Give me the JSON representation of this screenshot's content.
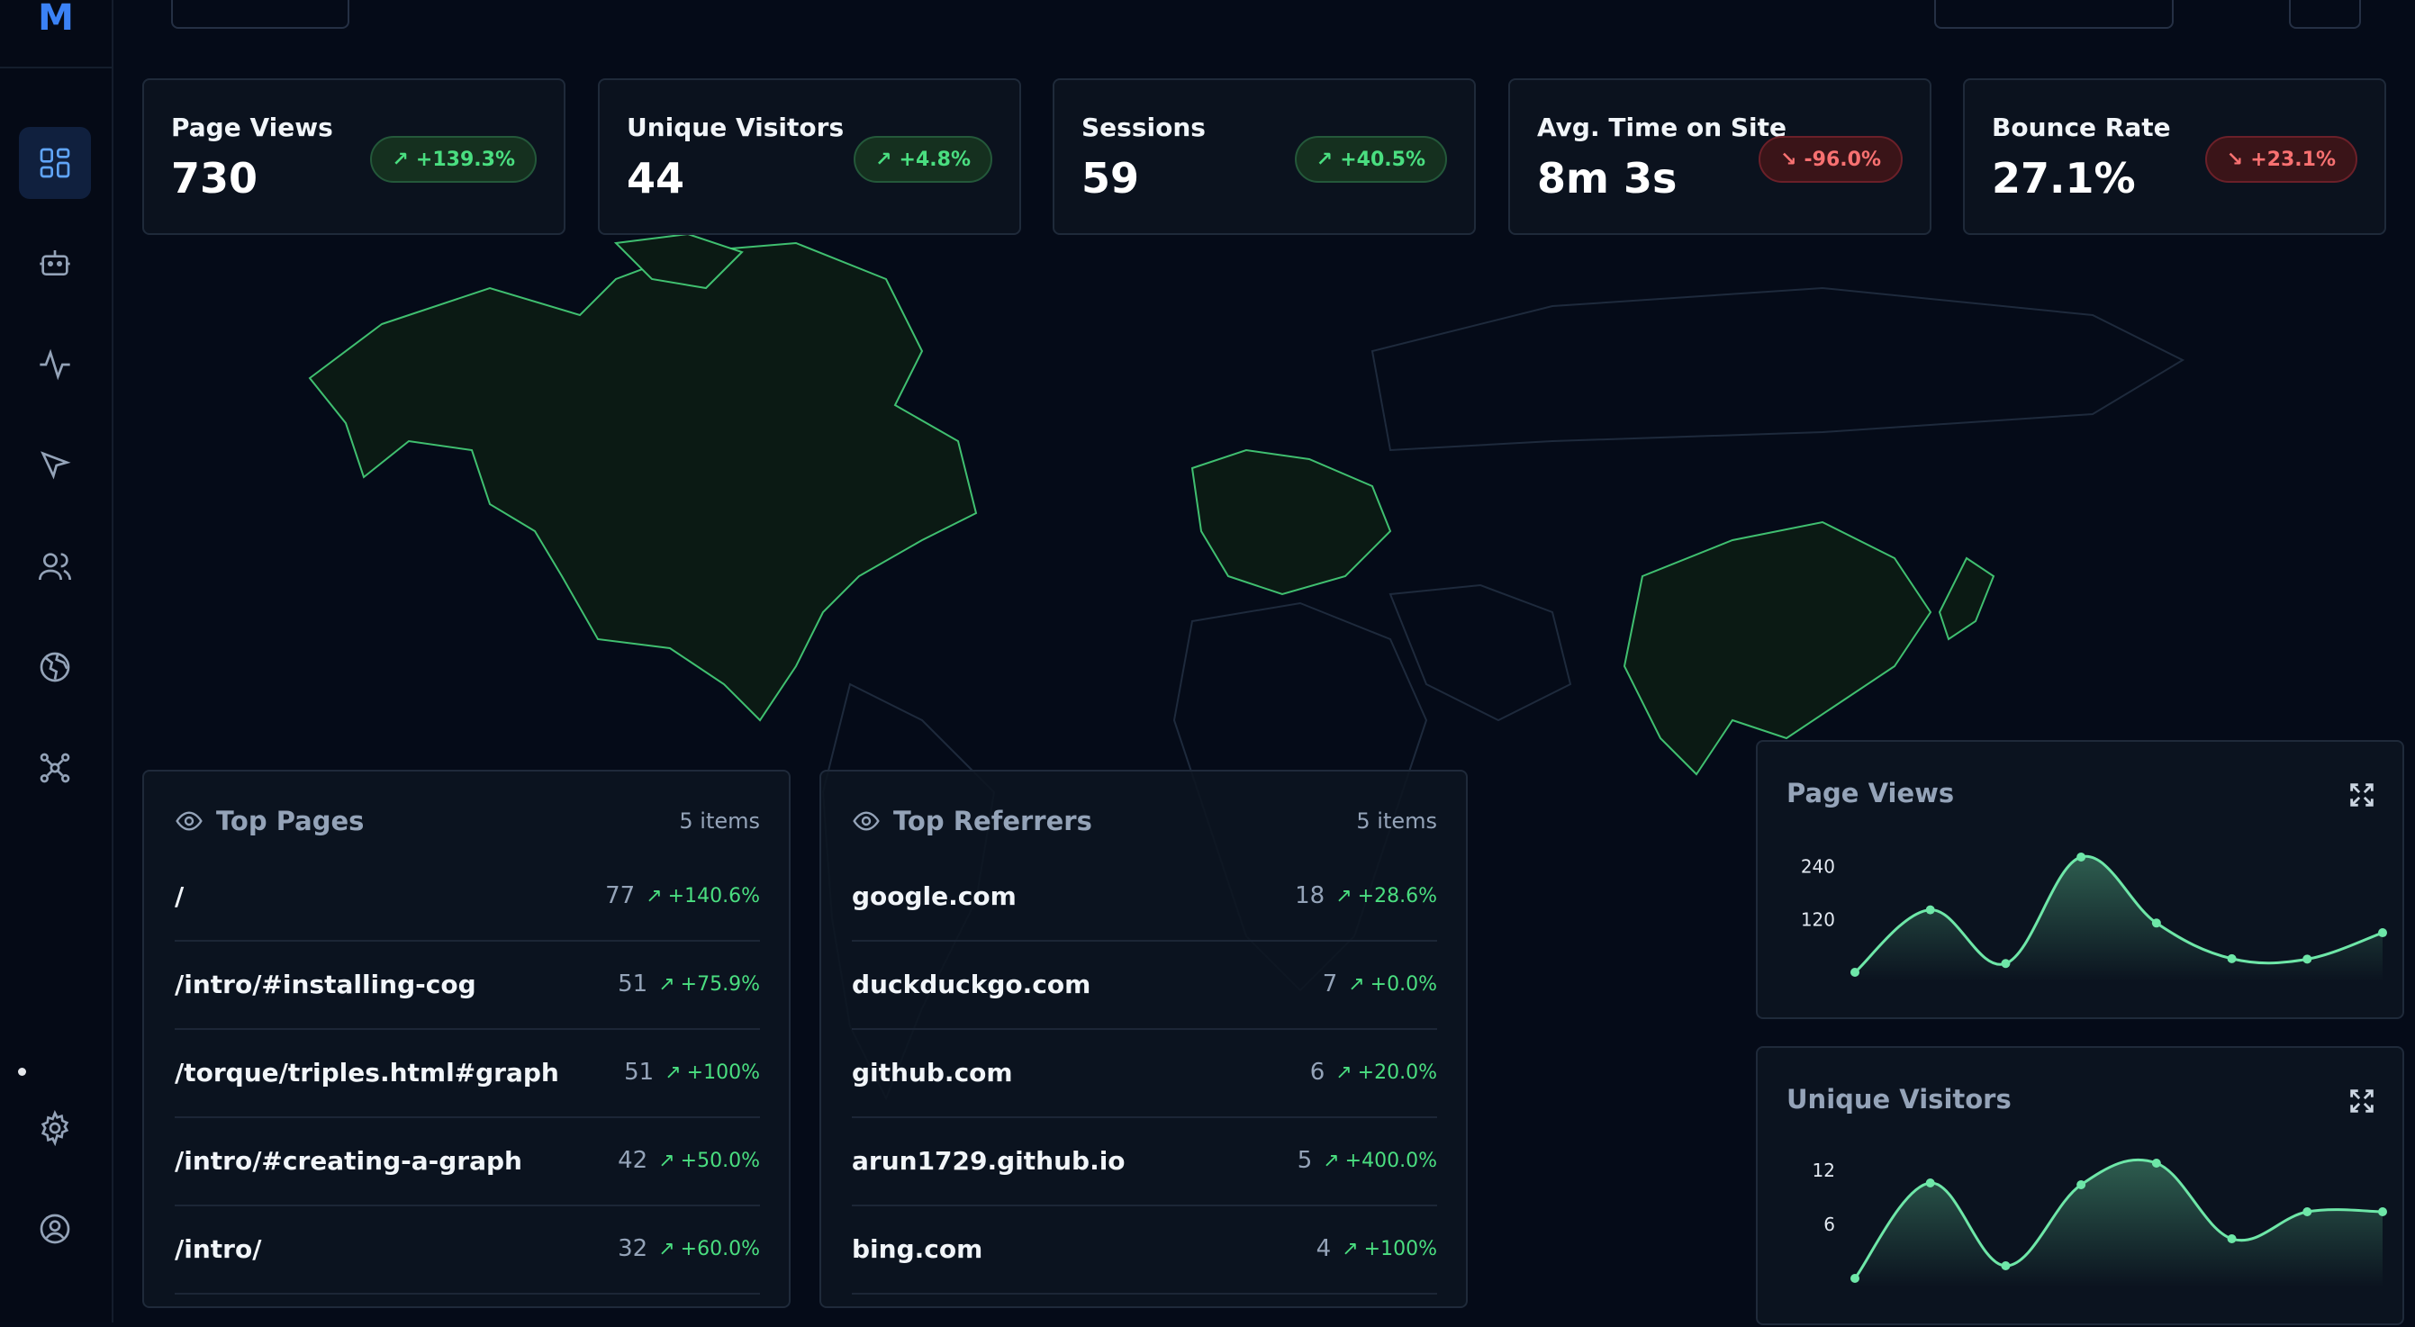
{
  "app": {
    "logo_letter": "M"
  },
  "sidebar": {
    "items": [
      {
        "icon": "dashboard-icon",
        "active": true
      },
      {
        "icon": "bot-icon"
      },
      {
        "icon": "activity-icon"
      },
      {
        "icon": "cursor-icon"
      },
      {
        "icon": "users-icon"
      },
      {
        "icon": "globe-icon"
      },
      {
        "icon": "network-icon"
      },
      {
        "icon": "gear-icon"
      },
      {
        "icon": "user-circle-icon"
      }
    ]
  },
  "stats": [
    {
      "title": "Page Views",
      "value": "730",
      "change": "+139.3%",
      "trend": "up"
    },
    {
      "title": "Unique Visitors",
      "value": "44",
      "change": "+4.8%",
      "trend": "up"
    },
    {
      "title": "Sessions",
      "value": "59",
      "change": "+40.5%",
      "trend": "up"
    },
    {
      "title": "Avg. Time on Site",
      "value": "8m 3s",
      "change": "-96.0%",
      "trend": "down"
    },
    {
      "title": "Bounce Rate",
      "value": "27.1%",
      "change": "+23.1%",
      "trend": "down"
    }
  ],
  "top_pages": {
    "title": "Top Pages",
    "count": "5 items",
    "rows": [
      {
        "label": "/",
        "value": "77",
        "change": "+140.6%"
      },
      {
        "label": "/intro/#installing-cog",
        "value": "51",
        "change": "+75.9%"
      },
      {
        "label": "/torque/triples.html#graph",
        "value": "51",
        "change": "+100%"
      },
      {
        "label": "/intro/#creating-a-graph",
        "value": "42",
        "change": "+50.0%"
      },
      {
        "label": "/intro/",
        "value": "32",
        "change": "+60.0%"
      }
    ]
  },
  "top_referrers": {
    "title": "Top Referrers",
    "count": "5 items",
    "rows": [
      {
        "label": "google.com",
        "value": "18",
        "change": "+28.6%"
      },
      {
        "label": "duckduckgo.com",
        "value": "7",
        "change": "+0.0%"
      },
      {
        "label": "github.com",
        "value": "6",
        "change": "+20.0%"
      },
      {
        "label": "arun1729.github.io",
        "value": "5",
        "change": "+400.0%"
      },
      {
        "label": "bing.com",
        "value": "4",
        "change": "+100%"
      }
    ]
  },
  "colors": {
    "accent": "#4ade80",
    "line": "#6ee7a8",
    "negative": "#f87171",
    "brand": "#3b82f6"
  },
  "chart_data": [
    {
      "type": "area",
      "title": "Page Views",
      "x": [
        0,
        1,
        2,
        3,
        4,
        5,
        6,
        7
      ],
      "values": [
        0,
        142,
        20,
        262,
        112,
        31,
        30,
        90
      ],
      "yticks": [
        "240",
        "120"
      ],
      "ylim": [
        0,
        262
      ]
    },
    {
      "type": "area",
      "title": "Unique Visitors",
      "x": [
        0,
        1,
        2,
        3,
        4,
        5,
        6,
        7
      ],
      "values": [
        0,
        10.6,
        1.4,
        10.4,
        12.8,
        4.4,
        7.4,
        7.4
      ],
      "yticks": [
        "12",
        "6"
      ],
      "ylim": [
        0,
        12.8
      ]
    }
  ]
}
